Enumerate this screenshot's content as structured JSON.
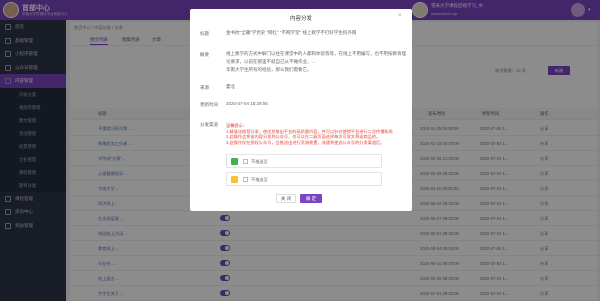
{
  "header": {
    "brand": "首部中心",
    "brand_sub": "华南大学学报社平台系统中心",
    "school_name": "雪采大学课程后端学习_中..",
    "school_url": "www.beixin.vip"
  },
  "sidebar": {
    "items": [
      {
        "label": "首页"
      },
      {
        "label": "基础管理"
      },
      {
        "label": "小程序管理"
      },
      {
        "label": "公众号管理"
      },
      {
        "label": "内容管理"
      }
    ],
    "sub_items": [
      {
        "label": "内容分类"
      },
      {
        "label": "视频库管理"
      },
      {
        "label": "图文管理"
      },
      {
        "label": "活动管理"
      },
      {
        "label": "投票管理"
      },
      {
        "label": "企业管理"
      },
      {
        "label": "课程管理"
      },
      {
        "label": "题目分类"
      }
    ],
    "bottom_items": [
      {
        "label": "课程管理"
      },
      {
        "label": "资讯中心"
      },
      {
        "label": "奖励管理"
      }
    ]
  },
  "breadcrumb": "首页中心  /  内容分类  /  文章",
  "tabs": [
    {
      "label": "图文列表"
    },
    {
      "label": "图集列表"
    },
    {
      "label": "文章"
    }
  ],
  "toolbar": {
    "page_size": "每页数量：10 条",
    "new_button": "新建"
  },
  "table": {
    "headers": [
      "标题",
      "状态",
      "排序",
      "阅读",
      "发布时间",
      "更新时间",
      "操作"
    ],
    "rows": [
      {
        "title": "不懂就问系列第 ...",
        "release": "2019-11-25 09:09:09",
        "update": "2020-07-04 1...",
        "read": "",
        "sort": "",
        "op": "分享"
      },
      {
        "title": "致敬医务工作者 ...",
        "release": "2020-01-23 09:00:00",
        "update": "2020-07-04 1...",
        "read": "",
        "sort": "",
        "op": "分享"
      },
      {
        "title": "学院讲\"全聚\"..",
        "release": "2020-02-05 21:00:00",
        "update": "2020-07-04 1...",
        "read": "",
        "sort": "",
        "op": "分享"
      },
      {
        "title": "心理健康指导 ...",
        "release": "2020-03-09 09:00:00",
        "update": "2020-07-04 1...",
        "read": "",
        "sort": "",
        "op": "分享"
      },
      {
        "title": "华南大学 ...",
        "release": "2020-04-11 09:00:00",
        "update": "2020-07-04 1...",
        "read": "",
        "sort": "",
        "op": "分享"
      },
      {
        "title": "同济线上\"...",
        "release": "2020-05-16 09:00:00",
        "update": "2020-07-04 1...",
        "read": "",
        "sort": "",
        "op": "分享"
      },
      {
        "title": "在这场疫情 ...",
        "release": "2020-05-27 09:00:00",
        "update": "2020-07-04 1...",
        "read": "",
        "sort": "",
        "op": "分享"
      },
      {
        "title": "校园线上活动 ...",
        "release": "2020-06-01 09:00:00",
        "update": "2020-07-04 1...",
        "read": "",
        "sort": "",
        "op": "分享"
      },
      {
        "title": "教育线上...",
        "release": "2020-06-04 09:00:00",
        "update": "2020-07-04 1...",
        "read": "",
        "sort": "",
        "op": "分享"
      },
      {
        "title": "毕业季...",
        "release": "2020-06-10 09:00:00",
        "update": "2020-07-04 1...",
        "read": "",
        "sort": "",
        "op": "分享"
      },
      {
        "title": "线上留言 ...",
        "release": "2020-06-25 09:00:00",
        "update": "2020-07-04 1...",
        "read": "",
        "sort": "",
        "op": "分享"
      },
      {
        "title": "大学生关于 ...",
        "release": "2020-07-01 09:00:00",
        "update": "2020-07-04 1...",
        "read": "",
        "sort": "",
        "op": "分享"
      }
    ]
  },
  "modal": {
    "title": "内容分发",
    "close": "×",
    "labels": {
      "title": "标题",
      "summary": "概要",
      "source": "来源",
      "update_time": "更新时间",
      "distribute": "分发渠道"
    },
    "values": {
      "title": "金书抗\"全疆\"学党史 \"网红\" \"不网学堂\" 线上教学不打好学生校外网",
      "summary": "线上教学的方式中解门以往在课堂中的人都和体验等等，在线上不用编写，也不用按教育理论要求，以前在那里不就自己从不做作业，...",
      "summary_line2": "华南大学生所有的经验，那么我们需要它。",
      "source": "霍北",
      "update_time": "2020-07-04 18:29:06"
    },
    "note_lines": [
      "温馨提示：",
      "1.精准化推荐分发，使优质推出平台的高质量内容，并可以针对使得平台进行二次传播和再",
      "2.此操作会将该内容分发到公众号，也可以在二级页面选择每次可发文章或商品的。",
      "3.此操作仅在授权公众号，会推送出进行资源装置，流通到使选公众号的分发渠道后。"
    ],
    "platforms": [
      {
        "name": "wechat",
        "label": "不推送至",
        "color": "#3fb34f"
      },
      {
        "name": "weibo",
        "label": "不推送至",
        "color": "#f4c432"
      }
    ],
    "cancel": "关 闭",
    "ok": "确 定"
  }
}
